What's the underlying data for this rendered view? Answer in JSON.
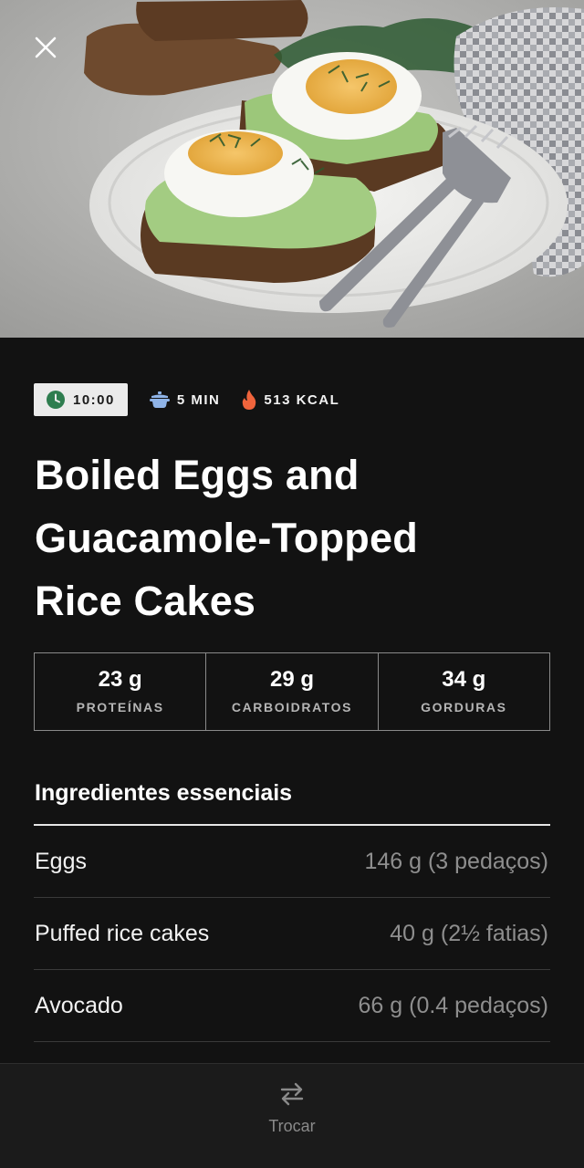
{
  "meta": {
    "time": "10:00",
    "duration": "5 MIN",
    "calories": "513 KCAL"
  },
  "recipe": {
    "title_lines": [
      "Boiled Eggs and",
      "Guacamole-Topped",
      "Rice Cakes"
    ]
  },
  "macros": [
    {
      "value": "23 g",
      "label": "PROTEÍNAS"
    },
    {
      "value": "29 g",
      "label": "CARBOIDRATOS"
    },
    {
      "value": "34 g",
      "label": "GORDURAS"
    }
  ],
  "ingredients": {
    "heading": "Ingredientes essenciais",
    "items": [
      {
        "name": "Eggs",
        "amount": "146 g (3 pedaços)"
      },
      {
        "name": "Puffed rice cakes",
        "amount": "40 g (2½ fatias)"
      },
      {
        "name": "Avocado",
        "amount": "66 g (0.4 pedaços)"
      }
    ]
  },
  "bottom_bar": {
    "swap_label": "Trocar"
  },
  "icons": {
    "close": "close-icon",
    "time": "clock-icon",
    "duration": "pot-icon",
    "calories": "flame-icon",
    "swap": "swap-arrows-icon"
  },
  "colors": {
    "background": "#121212",
    "clock_green": "#2e7d4f",
    "pot_blue": "#8fb4e8",
    "flame_orange": "#f0643c",
    "muted_text": "#8e8e8e"
  }
}
